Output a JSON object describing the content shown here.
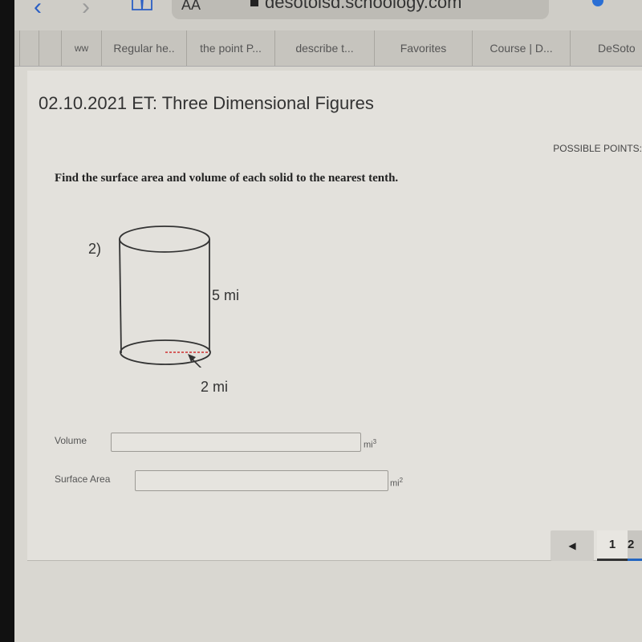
{
  "browser": {
    "back_icon": "chevron-left-icon",
    "forward_icon": "chevron-right-icon",
    "bookmarks_icon": "book-icon",
    "text_size_label": "AA",
    "url": "desotoisd.schoology.com",
    "tabs": [
      {
        "label": ""
      },
      {
        "label": ""
      },
      {
        "label": "ww"
      },
      {
        "label": "Regular he.."
      },
      {
        "label": "the point P..."
      },
      {
        "label": "describe t..."
      },
      {
        "label": "Favorites"
      },
      {
        "label": "Course | D..."
      },
      {
        "label": "DeSoto"
      }
    ]
  },
  "assignment": {
    "title": "02.10.2021 ET: Three Dimensional Figures",
    "possible_points_label": "POSSIBLE POINTS:",
    "instructions": "Find the surface area and volume of each solid to the nearest tenth."
  },
  "problem": {
    "number": "2)",
    "shape": "cylinder",
    "height_label": "5 mi",
    "radius_label": "2 mi",
    "radius_line_color": "#d03030"
  },
  "answers": {
    "volume": {
      "label": "Volume",
      "value": "",
      "unit": "mi",
      "unit_exp": "3"
    },
    "surface_area": {
      "label": "Surface Area",
      "value": "",
      "unit": "mi",
      "unit_exp": "2"
    }
  },
  "pagination": {
    "prev_icon": "triangle-left-icon",
    "prev_glyph": "◀",
    "pages": [
      "1",
      "2"
    ],
    "current_page": "2"
  }
}
